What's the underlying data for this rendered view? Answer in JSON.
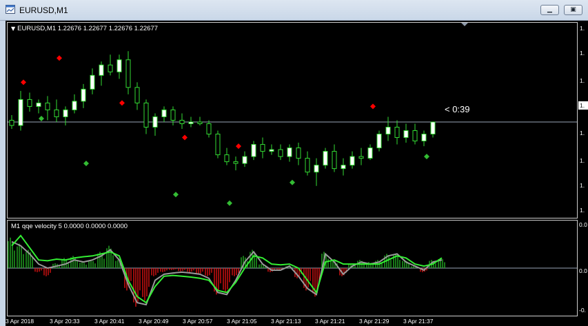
{
  "window": {
    "title": "EURUSD,M1",
    "minimize_icon": "minimize-icon",
    "restore_icon": "restore-icon",
    "close_icon": "close-icon"
  },
  "chart": {
    "label": "EURUSD,M1  1.22676 1.22677 1.22676 1.22677",
    "countdown": "< 0:39",
    "price_axis_labels": [
      "1.",
      "1.",
      "1.",
      "1.",
      "1.",
      "1.",
      "1.",
      "1.",
      "1."
    ],
    "current_price_label": "1.",
    "colors": {
      "background": "#000000",
      "bull_candle_body": "#ffffff",
      "candle_outline": "#33dd33",
      "bear_candle_body": "#000000",
      "sell_signal": "#ff0000",
      "buy_signal": "#33bb33",
      "bid_line": "#9aa6b8"
    }
  },
  "indicator": {
    "label": "M1  qqe velocity 5 0.0000 0.0000 0.0000",
    "axis_labels": [
      "0.0",
      "0.0",
      "-0."
    ],
    "colors": {
      "positive_histogram": "#22aa22",
      "negative_histogram": "#dd1111",
      "fast_line": "#33ee33",
      "slow_line": "#9a9a9a",
      "zero_line": "#9aa6b8"
    }
  },
  "time_axis": {
    "labels": [
      "3 Apr 2018",
      "3 Apr 20:33",
      "3 Apr 20:41",
      "3 Apr 20:49",
      "3 Apr 20:57",
      "3 Apr 21:05",
      "3 Apr 21:13",
      "3 Apr 21:21",
      "3 Apr 21:29",
      "3 Apr 21:37"
    ]
  },
  "chart_data": [
    {
      "type": "candlestick",
      "title": "EURUSD,M1",
      "last_quote": {
        "open": 1.22676,
        "high": 1.22677,
        "low": 1.22676,
        "close": 1.22677
      },
      "candles": [
        [
          1.22678,
          1.22681,
          1.22673,
          1.22675
        ],
        [
          1.22675,
          1.22695,
          1.22672,
          1.2269
        ],
        [
          1.2269,
          1.22694,
          1.22683,
          1.22686
        ],
        [
          1.22686,
          1.2269,
          1.22682,
          1.22688
        ],
        [
          1.22688,
          1.22692,
          1.22678,
          1.22684
        ],
        [
          1.22684,
          1.2269,
          1.22677,
          1.2268
        ],
        [
          1.2268,
          1.22686,
          1.22675,
          1.22684
        ],
        [
          1.22684,
          1.22693,
          1.22682,
          1.22689
        ],
        [
          1.22689,
          1.22699,
          1.22685,
          1.22696
        ],
        [
          1.22696,
          1.22708,
          1.22693,
          1.22704
        ],
        [
          1.22704,
          1.22712,
          1.22698,
          1.2271
        ],
        [
          1.2271,
          1.22716,
          1.22704,
          1.22706
        ],
        [
          1.22706,
          1.22716,
          1.22702,
          1.22713
        ],
        [
          1.22713,
          1.22718,
          1.22693,
          1.22697
        ],
        [
          1.22697,
          1.227,
          1.22684,
          1.22688
        ],
        [
          1.22688,
          1.2269,
          1.2267,
          1.22674
        ],
        [
          1.22674,
          1.22682,
          1.22669,
          1.2268
        ],
        [
          1.2268,
          1.22686,
          1.22677,
          1.22684
        ],
        [
          1.22684,
          1.22686,
          1.22675,
          1.22678
        ],
        [
          1.22678,
          1.22682,
          1.22673,
          1.22676
        ],
        [
          1.22676,
          1.2268,
          1.22674,
          1.22677
        ],
        [
          1.22677,
          1.2268,
          1.22675,
          1.22676
        ],
        [
          1.22676,
          1.22678,
          1.22668,
          1.2267
        ],
        [
          1.2267,
          1.22672,
          1.22656,
          1.22658
        ],
        [
          1.22658,
          1.22662,
          1.22652,
          1.22654
        ],
        [
          1.22654,
          1.22657,
          1.22649,
          1.22653
        ],
        [
          1.22653,
          1.2266,
          1.22651,
          1.22657
        ],
        [
          1.22657,
          1.22666,
          1.22655,
          1.22664
        ],
        [
          1.22664,
          1.22668,
          1.22656,
          1.2266
        ],
        [
          1.2266,
          1.22664,
          1.22658,
          1.22661
        ],
        [
          1.22661,
          1.22664,
          1.22655,
          1.22657
        ],
        [
          1.22657,
          1.22664,
          1.22654,
          1.22662
        ],
        [
          1.22662,
          1.22665,
          1.22652,
          1.22656
        ],
        [
          1.22656,
          1.2266,
          1.22646,
          1.22648
        ],
        [
          1.22648,
          1.22656,
          1.2264,
          1.22652
        ],
        [
          1.22652,
          1.22662,
          1.2265,
          1.2266
        ],
        [
          1.2266,
          1.22664,
          1.22648,
          1.2265
        ],
        [
          1.2265,
          1.22656,
          1.22646,
          1.22652
        ],
        [
          1.22652,
          1.2266,
          1.2265,
          1.22657
        ],
        [
          1.22657,
          1.22662,
          1.22652,
          1.22656
        ],
        [
          1.22656,
          1.22664,
          1.22655,
          1.22662
        ],
        [
          1.22662,
          1.22672,
          1.2266,
          1.2267
        ],
        [
          1.2267,
          1.2268,
          1.22666,
          1.22674
        ],
        [
          1.22674,
          1.22678,
          1.22664,
          1.22668
        ],
        [
          1.22668,
          1.22676,
          1.22665,
          1.22672
        ],
        [
          1.22672,
          1.22676,
          1.22664,
          1.22666
        ],
        [
          1.22666,
          1.22672,
          1.22663,
          1.2267
        ],
        [
          1.2267,
          1.22677,
          1.22668,
          1.22677
        ]
      ],
      "sell_signals": [
        [
          1,
          1.227
        ],
        [
          5,
          1.22714
        ],
        [
          12,
          1.22688
        ],
        [
          19,
          1.22668
        ],
        [
          25,
          1.22663
        ],
        [
          40,
          1.22686
        ]
      ],
      "buy_signals": [
        [
          3,
          1.22679
        ],
        [
          8,
          1.22653
        ],
        [
          18,
          1.22635
        ],
        [
          24,
          1.2263
        ],
        [
          31,
          1.22642
        ],
        [
          46,
          1.22657
        ]
      ]
    },
    {
      "type": "bar",
      "title": "qqe velocity 5",
      "histogram": [
        0.75,
        0.6,
        0.45,
        -0.1,
        -0.2,
        0.12,
        0.25,
        0.3,
        0.15,
        0.2,
        0.4,
        0.55,
        0.2,
        -0.55,
        -0.95,
        -0.8,
        -0.2,
        -0.1,
        -0.05,
        -0.08,
        -0.1,
        -0.15,
        -0.2,
        -0.65,
        -0.6,
        -0.2,
        0.3,
        0.45,
        0.1,
        -0.1,
        -0.05,
        0.05,
        -0.25,
        -0.55,
        -0.7,
        0.4,
        0.2,
        -0.2,
        0.1,
        0.2,
        0.15,
        0.2,
        0.35,
        0.35,
        0.2,
        0.05,
        -0.1,
        0.2,
        0.25
      ],
      "fast_line": [
        0.55,
        0.8,
        0.5,
        0.2,
        0.18,
        0.22,
        0.2,
        0.25,
        0.28,
        0.3,
        0.35,
        0.4,
        0.3,
        -0.3,
        -0.7,
        -0.85,
        -0.45,
        -0.2,
        -0.18,
        -0.2,
        -0.22,
        -0.25,
        -0.3,
        -0.55,
        -0.6,
        -0.35,
        0.0,
        0.3,
        0.25,
        0.1,
        0.08,
        0.1,
        0.0,
        -0.3,
        -0.6,
        0.15,
        0.2,
        0.1,
        0.1,
        0.1,
        0.1,
        0.1,
        0.2,
        0.3,
        0.25,
        0.1,
        0.05,
        0.1,
        0.25
      ],
      "slow_line": [
        0.65,
        0.55,
        0.35,
        0.1,
        0.0,
        0.05,
        0.1,
        0.2,
        0.15,
        0.2,
        0.3,
        0.45,
        0.2,
        -0.4,
        -0.85,
        -0.9,
        -0.3,
        -0.15,
        -0.12,
        -0.1,
        -0.12,
        -0.15,
        -0.25,
        -0.6,
        -0.65,
        -0.3,
        0.15,
        0.4,
        0.1,
        -0.05,
        -0.05,
        0.05,
        -0.2,
        -0.5,
        -0.65,
        0.35,
        0.15,
        -0.15,
        0.05,
        0.15,
        0.1,
        0.15,
        0.3,
        0.35,
        0.15,
        0.05,
        -0.05,
        0.15,
        0.2
      ],
      "ylim": [
        -1.0,
        1.0
      ]
    }
  ]
}
